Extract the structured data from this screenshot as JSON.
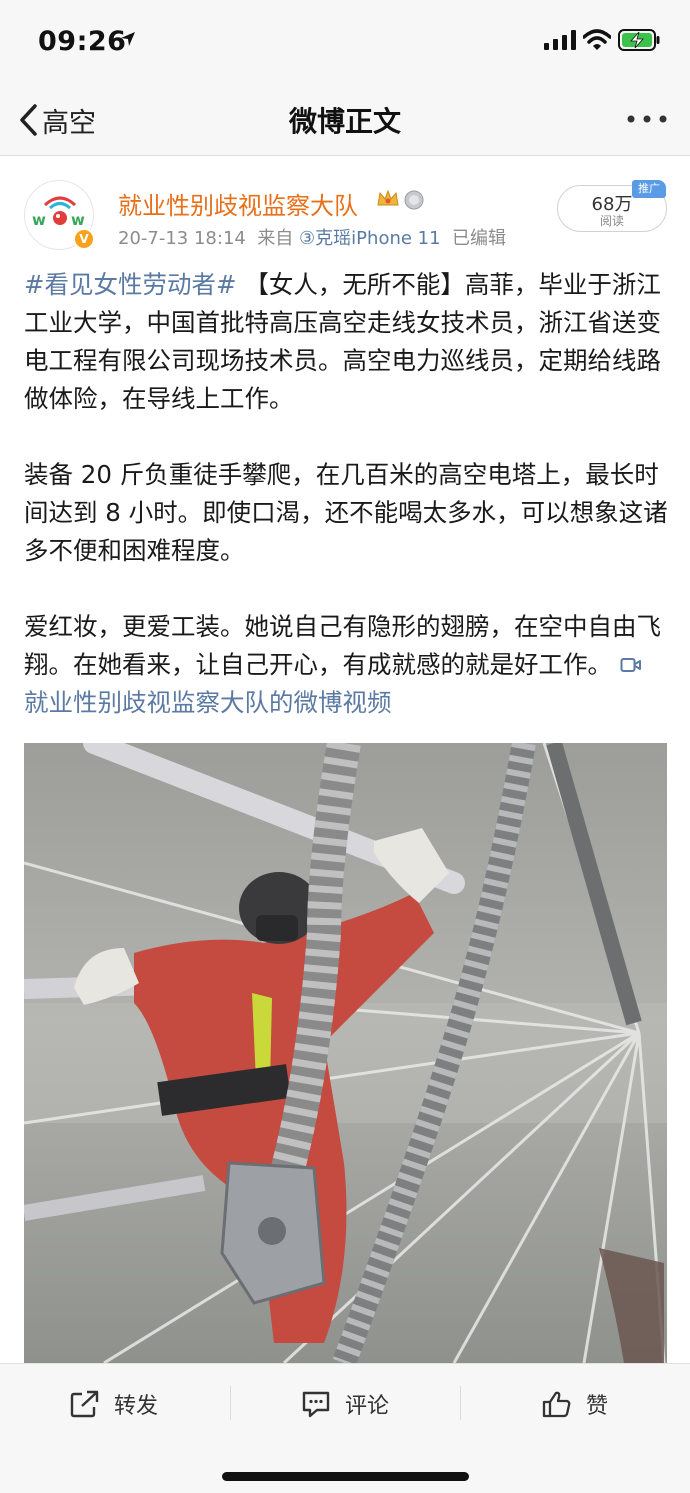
{
  "status_bar": {
    "time": "09:26",
    "icons": [
      "location-arrow-icon",
      "cellular-signal-icon",
      "wifi-icon",
      "battery-charging-icon"
    ],
    "battery_color": "#3cc24a"
  },
  "nav": {
    "back_label": "高空",
    "title": "微博正文",
    "more_icon": "more-dots-icon"
  },
  "post": {
    "author": "就业性别歧视监察大队",
    "author_color": "#e8701a",
    "timestamp": "20-7-13 18:14",
    "source_prefix": "来自",
    "client": "③克瑶iPhone 11",
    "edited": "已编辑",
    "reads": {
      "count": "68万",
      "label": "阅读",
      "promo": "推广"
    },
    "paragraph1": {
      "hashtag": "#看见女性劳动者#",
      "text": " 【女人，无所不能】高菲，毕业于浙江工业大学，中国首批特高压高空走线女技术员，浙江省送变电工程有限公司现场技术员。高空电力巡线员，定期给线路做体险，在导线上工作。"
    },
    "paragraph2": "装备 20 斤负重徒手攀爬，在几百米的高空电塔上，最长时间达到 8 小时。即使口渴，还不能喝太多水，可以想象这诸多不便和困难程度。",
    "paragraph3": {
      "text": "爱红妆，更爱工装。她说自己有隐形的翅膀，在空中自由飞翔。在她看来，让自己开心，有成就感的就是好工作。 ",
      "video_link": "就业性别歧视监察大队的微博视频"
    },
    "link_color": "#5b7aa3"
  },
  "actions": {
    "repost": "转发",
    "comment": "评论",
    "like": "赞"
  }
}
